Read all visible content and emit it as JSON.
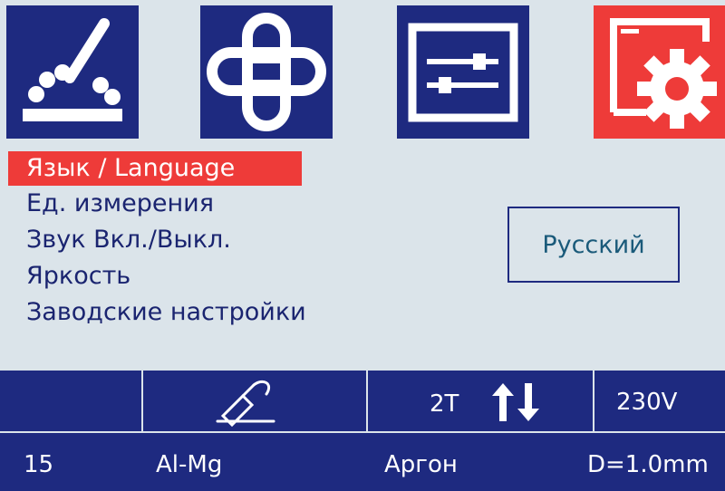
{
  "tiles": [
    {
      "icon": "weld-process-icon"
    },
    {
      "icon": "link-settings-icon"
    },
    {
      "icon": "sliders-icon"
    },
    {
      "icon": "settings-gear-icon",
      "active": true
    }
  ],
  "menu": {
    "items": [
      {
        "label": "Язык / Language",
        "selected": true
      },
      {
        "label": "Ед. измерения"
      },
      {
        "label": "Звук Вкл./Выкл."
      },
      {
        "label": "Яркость"
      },
      {
        "label": "Заводские настройки"
      }
    ]
  },
  "value": {
    "text": "Русский"
  },
  "status_top": {
    "mode": "2Т",
    "voltage": "230V"
  },
  "status_bottom": {
    "number": "15",
    "material": "Al-Mg",
    "gas": "Аргон",
    "diameter": "D=1.0mm"
  },
  "colors": {
    "navy": "#1e2a80",
    "accent_red": "#ee3b39",
    "background": "#dbe4ea"
  }
}
